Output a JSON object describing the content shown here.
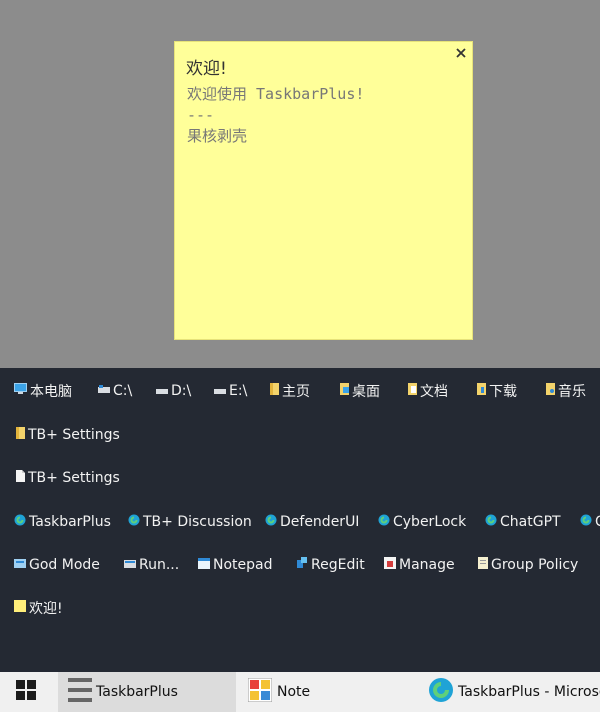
{
  "note": {
    "title": "欢迎!",
    "lines": [
      "欢迎使用 TaskbarPlus!",
      "---",
      "果核剥壳"
    ],
    "close_glyph": "✕",
    "bg_color": "#ffff99"
  },
  "panel": {
    "rows": [
      {
        "items": [
          {
            "label": "本电脑",
            "icon": "computer-icon"
          },
          {
            "label": "C:\\",
            "icon": "drive-icon"
          },
          {
            "label": "D:\\",
            "icon": "drive-icon"
          },
          {
            "label": "E:\\",
            "icon": "drive-icon"
          },
          {
            "label": "主页",
            "icon": "folder-icon"
          },
          {
            "label": "桌面",
            "icon": "folder-icon"
          },
          {
            "label": "文档",
            "icon": "folder-icon"
          },
          {
            "label": "下载",
            "icon": "folder-icon"
          },
          {
            "label": "音乐",
            "icon": "folder-icon"
          }
        ]
      },
      {
        "items": [
          {
            "label": "TB+ Settings",
            "icon": "folder-icon"
          }
        ]
      },
      {
        "items": [
          {
            "label": "TB+ Settings",
            "icon": "file-icon"
          }
        ]
      },
      {
        "items": [
          {
            "label": "TaskbarPlus",
            "icon": "edge-icon"
          },
          {
            "label": "TB+ Discussion",
            "icon": "edge-icon"
          },
          {
            "label": "DefenderUI",
            "icon": "edge-icon"
          },
          {
            "label": "CyberLock",
            "icon": "edge-icon"
          },
          {
            "label": "ChatGPT",
            "icon": "edge-icon"
          },
          {
            "label": "C",
            "icon": "edge-icon"
          }
        ]
      },
      {
        "items": [
          {
            "label": "God Mode",
            "icon": "control-panel-icon"
          },
          {
            "label": "Run...",
            "icon": "run-icon"
          },
          {
            "label": "Notepad",
            "icon": "notepad-icon"
          },
          {
            "label": "RegEdit",
            "icon": "regedit-icon"
          },
          {
            "label": "Manage",
            "icon": "manage-icon"
          },
          {
            "label": "Group Policy",
            "icon": "policy-icon"
          }
        ]
      },
      {
        "items": [
          {
            "label": "欢迎!",
            "icon": "sticky-note-icon"
          }
        ]
      }
    ]
  },
  "taskbar": {
    "items": [
      {
        "label": "",
        "icon": "windows-start-icon"
      },
      {
        "label": "TaskbarPlus",
        "icon": "taskbarplus-icon",
        "active": true
      },
      {
        "label": "Note",
        "icon": "note-app-icon"
      },
      {
        "label": "TaskbarPlus - Microsoft Edge",
        "icon": "edge-icon"
      }
    ]
  }
}
